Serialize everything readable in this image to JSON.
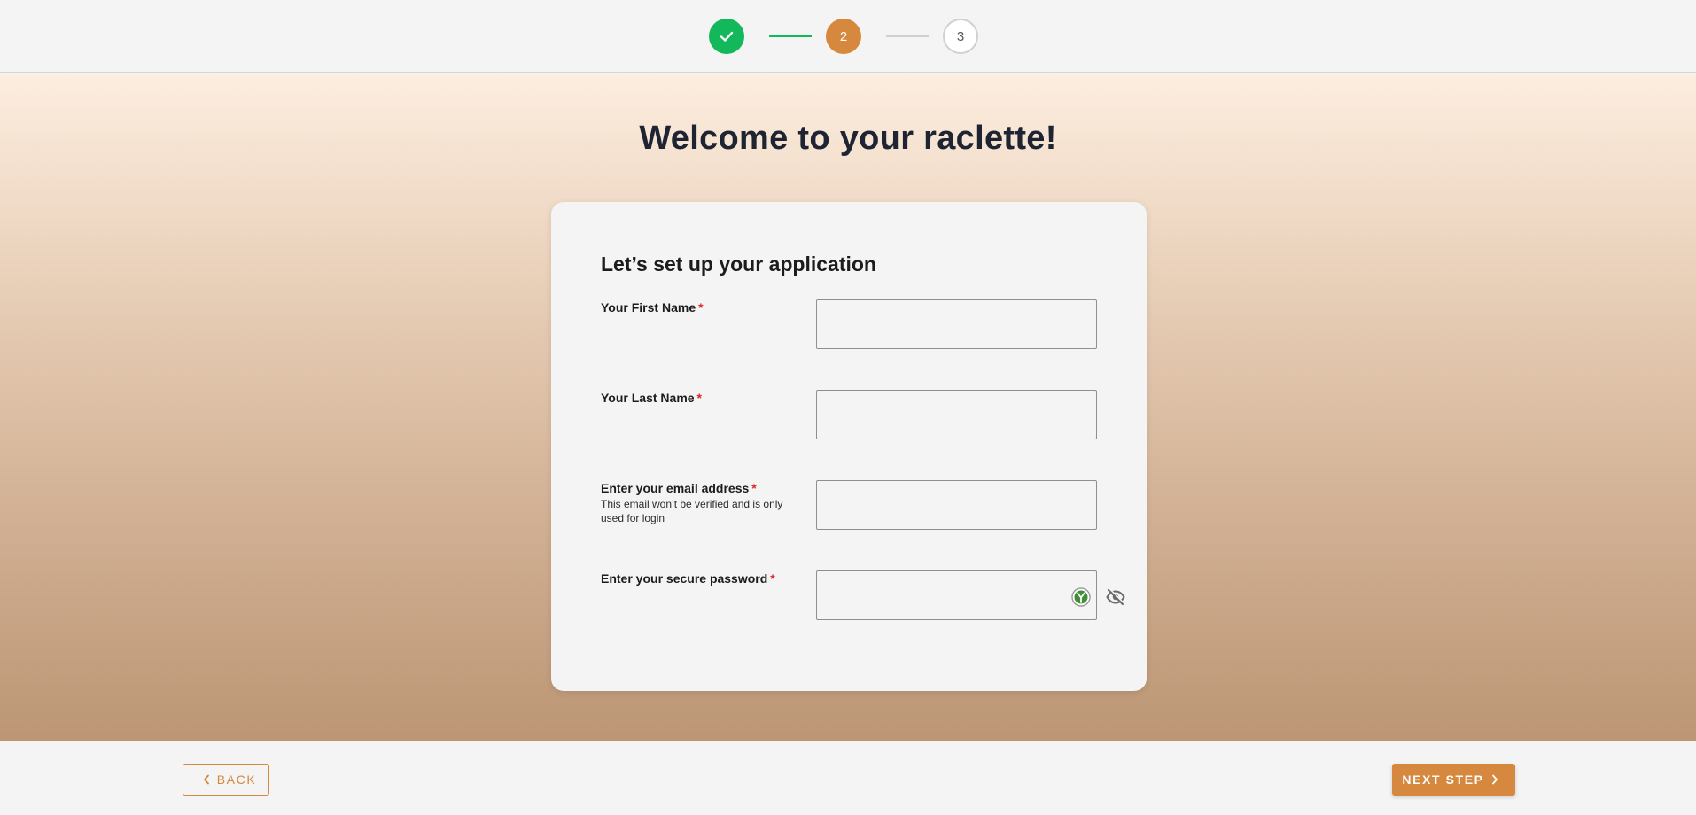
{
  "stepper": {
    "steps": [
      {
        "state": "completed",
        "icon": "check-icon",
        "color": "#12b85a"
      },
      {
        "label": "2",
        "state": "active",
        "color": "#d6883e"
      },
      {
        "label": "3",
        "state": "upcoming"
      }
    ]
  },
  "main": {
    "title": "Welcome to your raclette!"
  },
  "form": {
    "title": "Let’s set up your application",
    "fields": [
      {
        "label": "Your First Name",
        "required_mark": "*",
        "value": ""
      },
      {
        "label": "Your Last Name",
        "required_mark": "*",
        "value": ""
      },
      {
        "label": "Enter your email address",
        "required_mark": "*",
        "help": "This email won’t be verified and is only used for login",
        "value": ""
      },
      {
        "label": "Enter your secure password",
        "required_mark": "*",
        "value": "",
        "icons": [
          "password-strength-icon",
          "eye-slash-icon"
        ]
      }
    ]
  },
  "footer": {
    "back_label": "BACK",
    "next_label": "NEXT STEP"
  },
  "colors": {
    "accent": "#d6883e",
    "success": "#12b85a",
    "required": "#e02424"
  }
}
